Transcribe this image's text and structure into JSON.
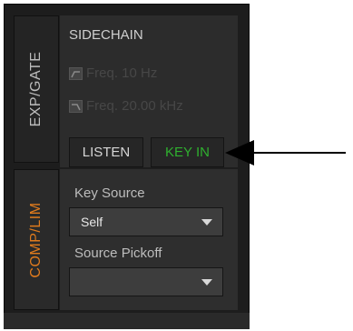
{
  "tabs": {
    "exp_gate": "EXP/GATE",
    "comp_lim": "COMP/LIM"
  },
  "sidechain": {
    "title": "SIDECHAIN",
    "filter1": "Freq. 10 Hz",
    "filter2": "Freq. 20.00 kHz",
    "listen_label": "LISTEN",
    "keyin_label": "KEY IN"
  },
  "key_source": {
    "label": "Key Source",
    "value": "Self"
  },
  "source_pickoff": {
    "label": "Source Pickoff",
    "value": ""
  },
  "colors": {
    "active_tab": "#e07b1d",
    "keyin_active": "#2fb02f"
  },
  "icons": [
    "high-pass-filter-icon",
    "low-pass-filter-icon",
    "dropdown-caret-icon",
    "callout-arrow-icon"
  ]
}
